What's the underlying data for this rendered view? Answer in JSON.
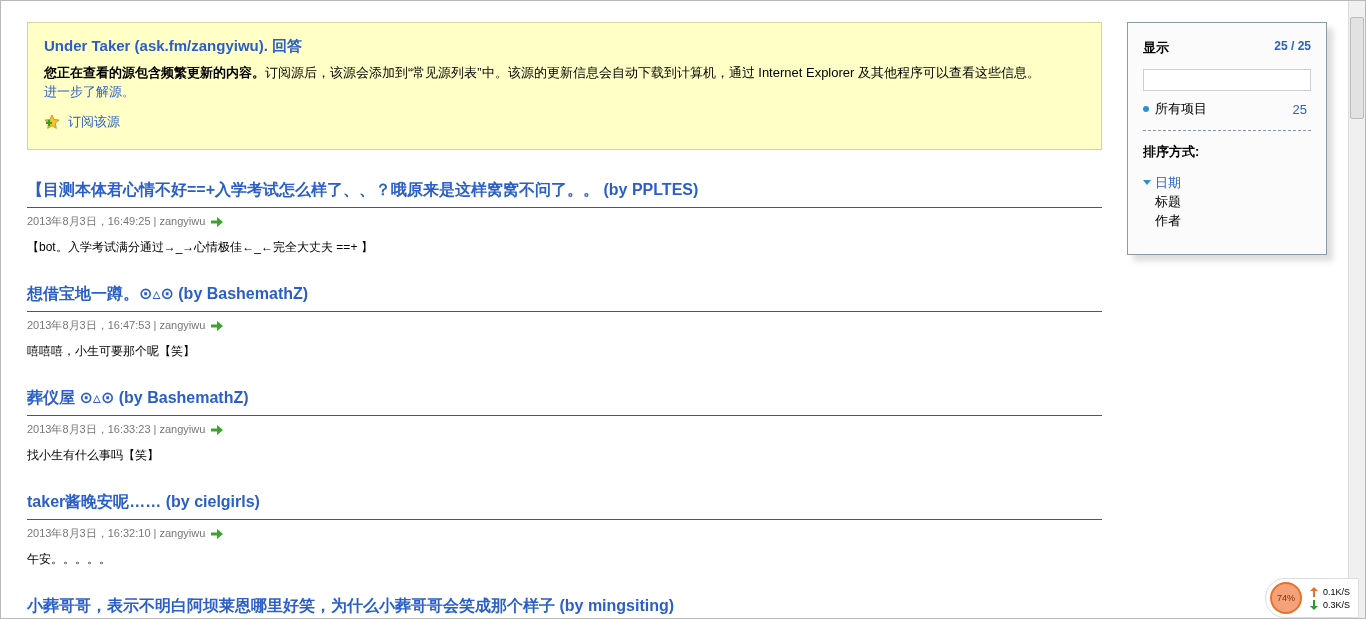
{
  "feed_banner": {
    "title": "Under Taker (ask.fm/zangyiwu). 回答",
    "description": "**您正在查看的源包含频繁更新的内容。**订阅源后，该源会添加到“常见源列表”中。该源的更新信息会自动下载到计算机，通过 Internet Explorer 及其他程序可以查看这些信息。",
    "learn_more_link": "进一步了解源。",
    "subscribe_link": "订阅该源"
  },
  "entries": [
    {
      "title": "【目测本体君心情不好==+入学考试怎么样了、、？哦原来是这样窝窝不问了。。 (by PPLTES)",
      "meta": "2013年8月3日，16:49:25 | zangyiwu",
      "body": "【bot。入学考试满分通过→_→心情极佳←_←完全大丈夫 ==+ 】"
    },
    {
      "title": "想借宝地一蹲。⊙▵⊙ (by BashemathZ)",
      "meta": "2013年8月3日，16:47:53 | zangyiwu",
      "body": "嘻嘻嘻，小生可要那个呢【笑】"
    },
    {
      "title": "葬仪屋 ⊙▵⊙ (by BashemathZ)",
      "meta": "2013年8月3日，16:33:23 | zangyiwu",
      "body": "找小生有什么事吗【笑】"
    },
    {
      "title": "taker酱晚安呢…… (by cielgirls)",
      "meta": "2013年8月3日，16:32:10 | zangyiwu",
      "body": "午安。。。。。"
    },
    {
      "title": "小葬哥哥，表示不明白阿坝莱恩哪里好笑，为什么小葬哥哥会笑成那个样子 (by mingsiting)"
    }
  ],
  "sidebar": {
    "display_label": "显示",
    "display_count": "25 / 25",
    "filters": [
      {
        "label": "所有项目",
        "count": "25",
        "selected": true
      }
    ],
    "sort_label": "排序方式:",
    "sort_options": [
      {
        "label": "日期",
        "selected": true
      },
      {
        "label": "标题",
        "selected": false
      },
      {
        "label": "作者",
        "selected": false
      }
    ]
  },
  "network_widget": {
    "percent": "74%",
    "upload": "0.1K/S",
    "download": "0.3K/S"
  }
}
